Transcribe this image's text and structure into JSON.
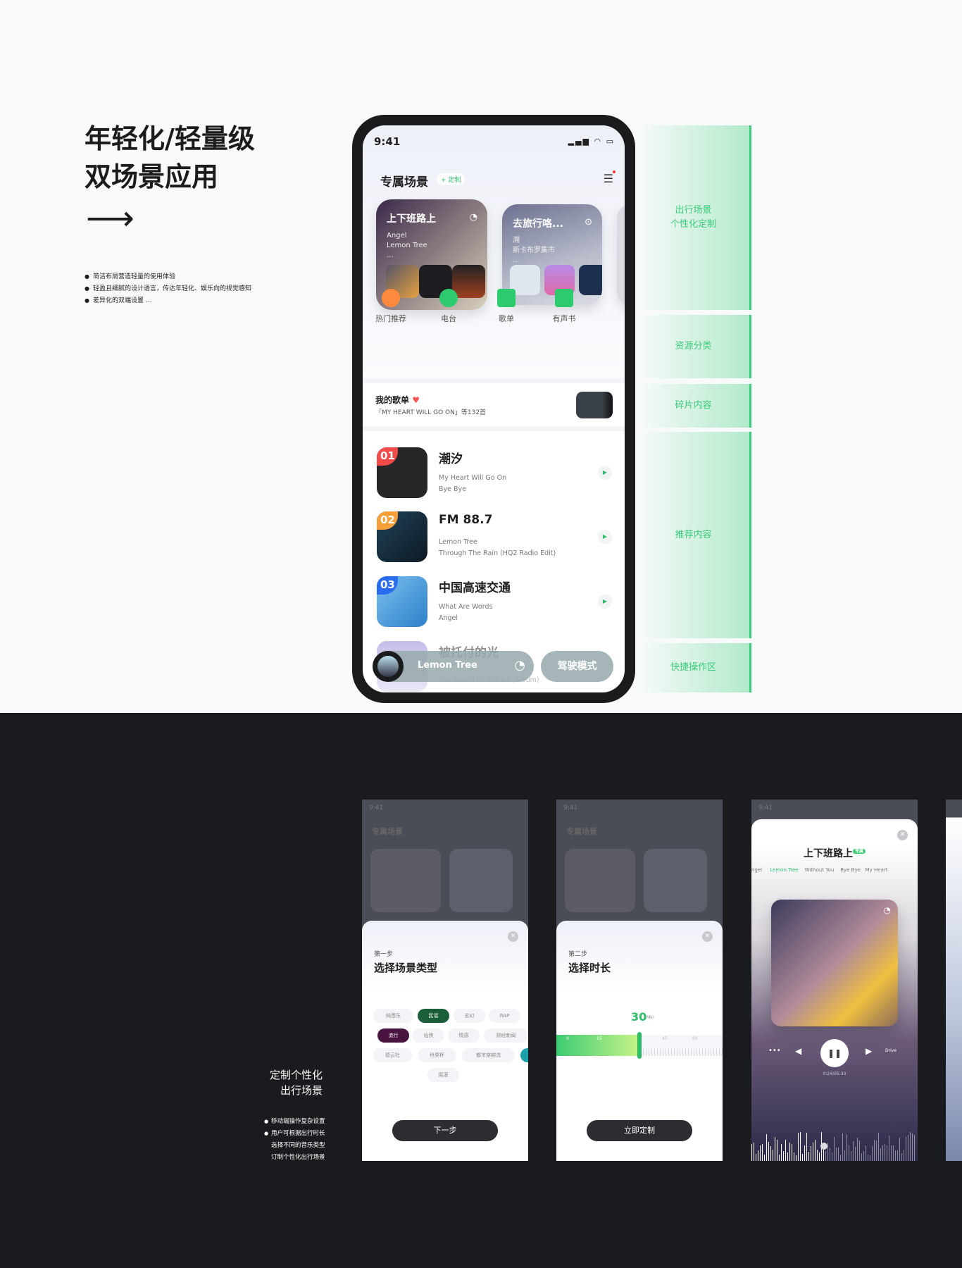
{
  "intro": {
    "title_line1": "年轻化/轻量级",
    "title_line2": "双场景应用",
    "arrow": "⟶",
    "bullets": [
      "简洁布局营造轻量的使用体验",
      "轻盈且细腻的设计语言，传达年轻化、娱乐向的视觉感知",
      "差异化的双端设置 ..."
    ]
  },
  "phone": {
    "time": "9:41",
    "status_icons": "signal wifi battery",
    "section_title": "专属场景",
    "customize": "+ 定制",
    "scenes": [
      {
        "title": "上下班路上",
        "songs": [
          "Angel",
          "Lemon Tree",
          "..."
        ],
        "icon": "music-note-icon"
      },
      {
        "title": "去旅行咯...",
        "songs": [
          "溯",
          "斯卡布罗集市",
          "..."
        ],
        "icon": "play-circle-icon"
      }
    ],
    "categories": [
      {
        "label": "热门推荐",
        "icon": "hot-fire-icon",
        "color": "#ff8a3d"
      },
      {
        "label": "电台",
        "icon": "radio-icon",
        "color": "#2dcb6e"
      },
      {
        "label": "歌单",
        "icon": "music-note-icon",
        "color": "#2dcb6e"
      },
      {
        "label": "有声书",
        "icon": "book-icon",
        "color": "#2dcb6e"
      }
    ],
    "my_playlist": {
      "title": "我的歌单",
      "subtitle": "「MY HEART WILL GO ON」等132首"
    },
    "list": [
      {
        "rank": "01",
        "title": "潮汐",
        "sub1": "My Heart Will Go On",
        "sub2": "Bye Bye",
        "color": "#f24b4b"
      },
      {
        "rank": "02",
        "title": "FM 88.7",
        "sub1": "Lemon Tree",
        "sub2": "Through The Rain (HQ2 Radio Edit)",
        "color": "#f7a03a"
      },
      {
        "rank": "03",
        "title": "中国高速交通",
        "sub1": "What Are Words",
        "sub2": "Angel",
        "color": "#2a6cf0"
      },
      {
        "rank": "",
        "title": "被托付的光",
        "sub1": "",
        "sub2": "The Sound Of Silence (Album)",
        "color": ""
      }
    ],
    "now_playing": "Lemon Tree",
    "drive_mode": "驾驶模式"
  },
  "annotations": [
    "出行场景\n个性化定制",
    "资源分类",
    "碎片内容",
    "推荐内容",
    "快捷操作区"
  ],
  "dark": {
    "title_line1": "定制个性化",
    "title_line2": "出行场景",
    "bullets": [
      "移动端操作复杂设置",
      "用户可根据出行时长",
      "选择不同的音乐类型",
      "订制个性化出行场景"
    ]
  },
  "step1": {
    "step": "第一步",
    "title": "选择场景类型",
    "tags": [
      "纯音乐",
      "民谣",
      "玄幻",
      "RAP",
      "流行",
      "仙侠",
      "情感",
      "财经新闻",
      "德云社",
      "世界杯",
      "都市穿越流",
      "摇滚"
    ],
    "next": "下一步"
  },
  "step2": {
    "step": "第二步",
    "title": "选择时长",
    "value": "30",
    "unit": "Min",
    "ticks": [
      "0",
      "15",
      "45",
      "60"
    ],
    "cta": "立即定制"
  },
  "player": {
    "title": "上下班路上",
    "badge": "专属",
    "tabs": [
      "ngel",
      "Lemon Tree",
      "Without You",
      "Bye Bye",
      "My Heart"
    ],
    "drive": "Drive",
    "time": "0:24/05:30",
    "progress": 0.073
  },
  "colors": {
    "accent": "#2dbd6a",
    "dark_bg": "#1a1b1e"
  }
}
